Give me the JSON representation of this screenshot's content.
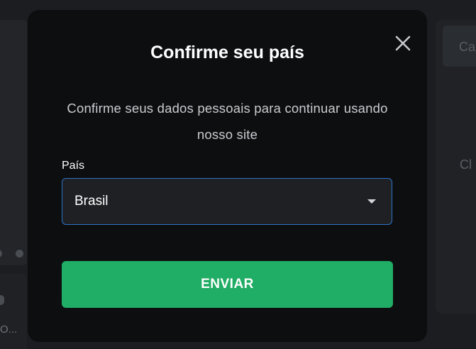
{
  "background": {
    "right_button_text": "Ca",
    "right_text": "Cl",
    "left_text": "O..."
  },
  "modal": {
    "title": "Confirme seu país",
    "close_icon": "close-icon",
    "description": "Confirme seus dados pessoais para continuar usando nosso site",
    "country_field": {
      "label": "País",
      "selected_value": "Brasil"
    },
    "submit_label": "ENVIAR"
  },
  "colors": {
    "modal_background": "#0d0e10",
    "submit_button": "#20ad65",
    "select_border": "#2f73c8"
  }
}
